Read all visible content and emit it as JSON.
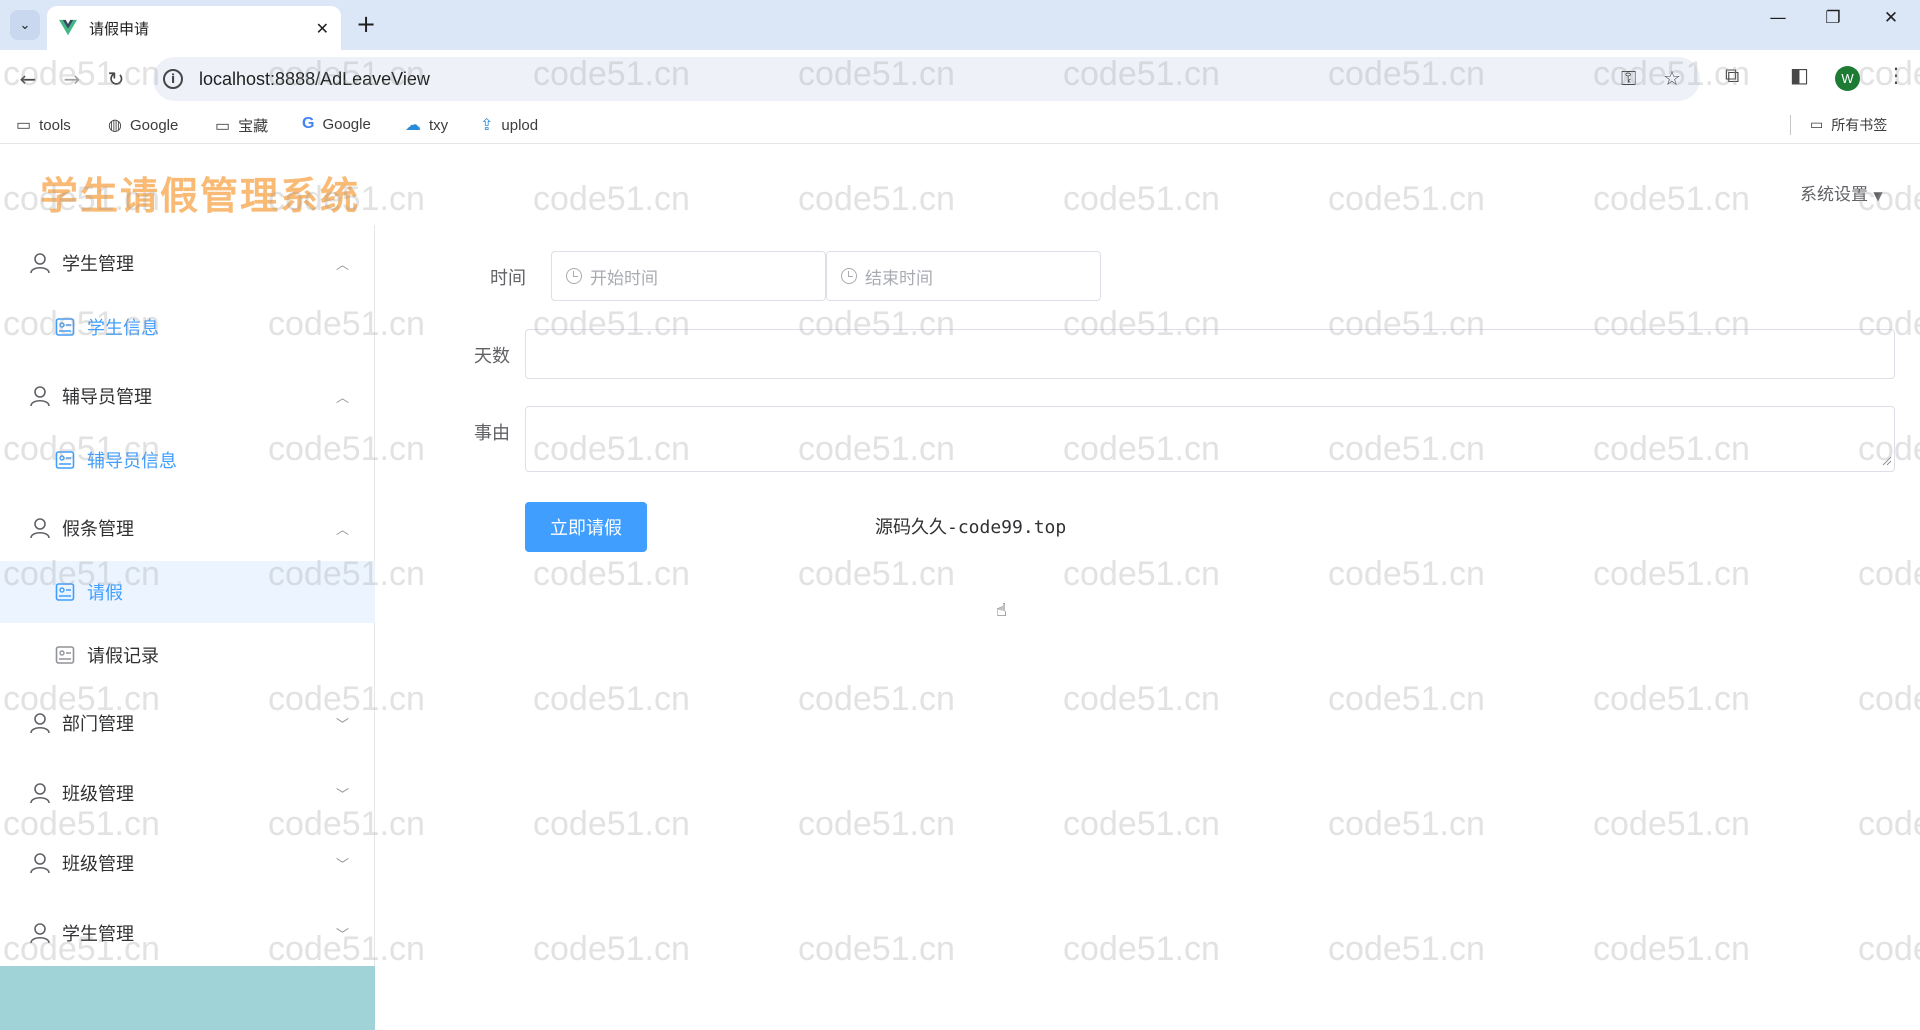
{
  "browser": {
    "tab_title": "请假申请",
    "new_tab_label": "+",
    "url": "localhost:8888/AdLeaveView",
    "profile_initial": "W",
    "bookmarks": [
      {
        "label": "tools",
        "icon": "folder-icon"
      },
      {
        "label": "Google",
        "icon": "globe-icon"
      },
      {
        "label": "宝藏",
        "icon": "folder-icon"
      },
      {
        "label": "Google",
        "icon": "google-icon"
      },
      {
        "label": "txy",
        "icon": "cloud-icon"
      },
      {
        "label": "uplod",
        "icon": "upload-icon"
      }
    ],
    "all_bookmarks_label": "所有书签"
  },
  "app": {
    "logo_text": "学生请假管理系统",
    "settings_label": "系统设置"
  },
  "sidebar": {
    "groups": [
      {
        "label": "学生管理",
        "expanded": true,
        "items": [
          "学生信息"
        ]
      },
      {
        "label": "辅导员管理",
        "expanded": true,
        "items": [
          "辅导员信息"
        ]
      },
      {
        "label": "假条管理",
        "expanded": true,
        "items": [
          "请假",
          "请假记录"
        ]
      },
      {
        "label": "部门管理",
        "expanded": false
      },
      {
        "label": "班级管理",
        "expanded": false
      },
      {
        "label": "班级管理",
        "expanded": false
      },
      {
        "label": "学生管理",
        "expanded": false
      }
    ],
    "active_item": "请假"
  },
  "form": {
    "time_label": "时间",
    "start_placeholder": "开始时间",
    "end_placeholder": "结束时间",
    "days_label": "天数",
    "days_value": "",
    "reason_label": "事由",
    "reason_value": "",
    "submit_label": "立即请假",
    "source_text": "源码久久-code99.top"
  },
  "watermark": {
    "text": "code51.cn"
  },
  "colors": {
    "primary": "#409eff",
    "logo": "#f8ba75",
    "active_bg": "#ecf5ff",
    "sidebar_bottom": "#9fd3d7"
  }
}
